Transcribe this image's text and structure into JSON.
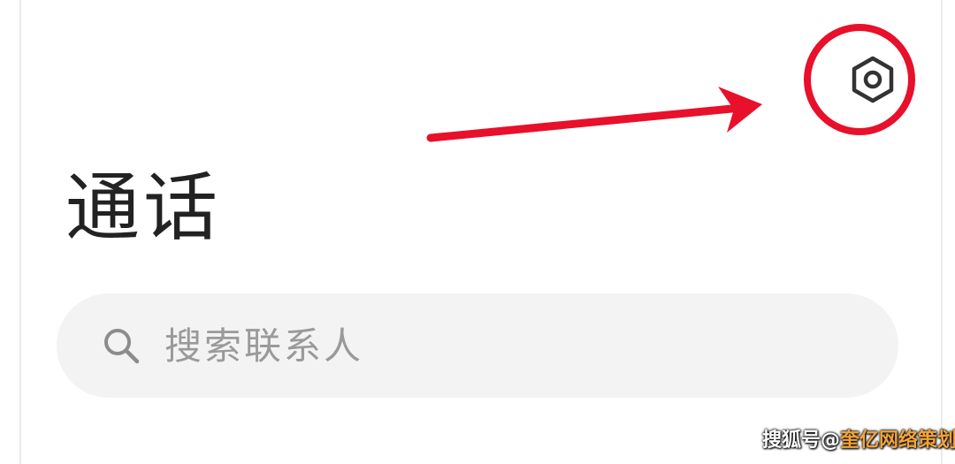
{
  "header": {
    "settings_icon": "hex-nut-settings-icon"
  },
  "annotation": {
    "color": "#e8102a"
  },
  "page": {
    "title": "通话"
  },
  "search": {
    "placeholder": "搜索联系人",
    "value": "",
    "icon": "search-icon"
  },
  "watermark": {
    "prefix": "搜狐号@",
    "brand": "奎亿网络策划"
  }
}
